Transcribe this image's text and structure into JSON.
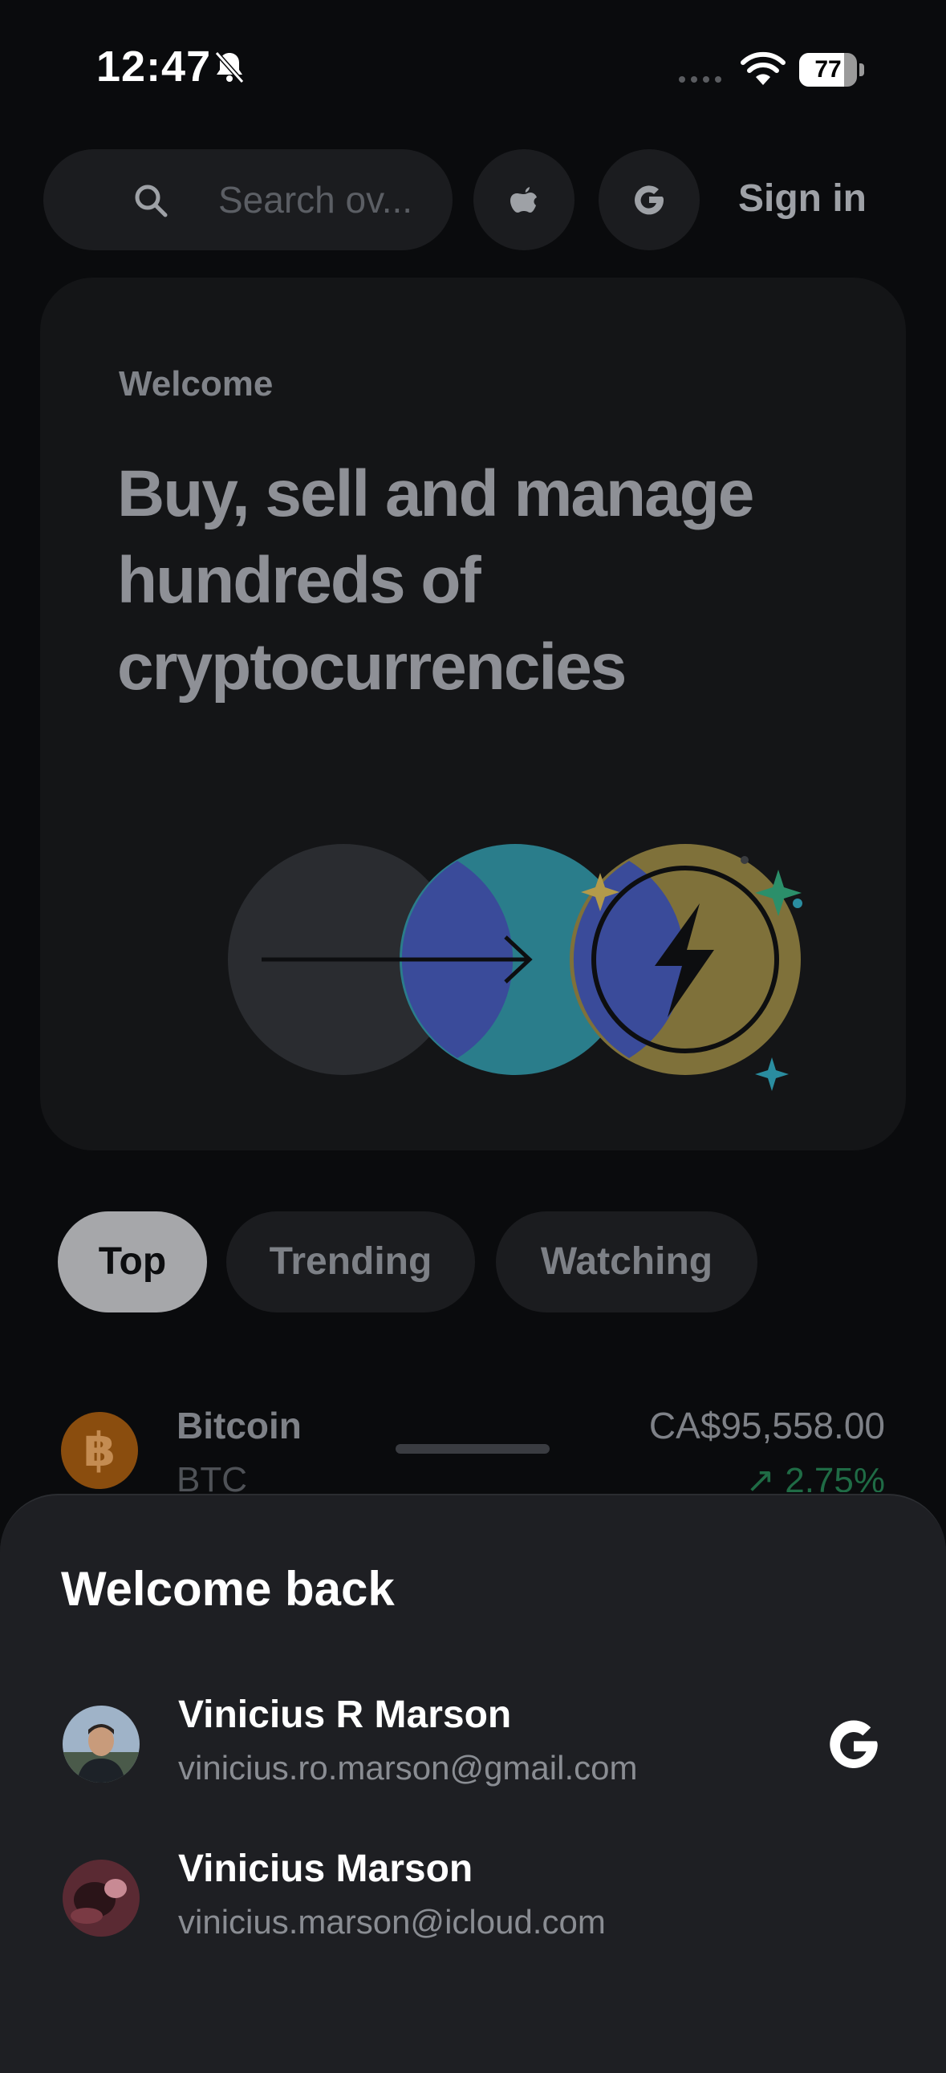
{
  "status_bar": {
    "time": "12:47",
    "battery": "77",
    "battery_level": 0.77,
    "icons": [
      "bell-slash-icon",
      "signal-icon",
      "wifi-icon",
      "battery-icon"
    ]
  },
  "top_bar": {
    "search_placeholder": "Search ov...",
    "apple_icon": "apple-icon",
    "google_icon": "google-icon",
    "sign_in": "Sign in"
  },
  "welcome_card": {
    "eyebrow": "Welcome",
    "title": "Buy, sell and manage hundreds of cryptocurrencies"
  },
  "tabs": [
    {
      "label": "Top",
      "active": true
    },
    {
      "label": "Trending",
      "active": false
    },
    {
      "label": "Watching",
      "active": false
    }
  ],
  "assets": [
    {
      "name": "Bitcoin",
      "symbol": "BTC",
      "price": "CA$95,558.00",
      "change": "↗ 2.75%",
      "icon": "bitcoin-icon"
    }
  ],
  "sheet": {
    "title": "Welcome back",
    "accounts": [
      {
        "name": "Vinicius R Marson",
        "email": "vinicius.ro.marson@gmail.com",
        "provider_icon": "google-icon"
      },
      {
        "name": "Vinicius Marson",
        "email": "vinicius.marson@icloud.com",
        "provider_icon": ""
      }
    ]
  },
  "colors": {
    "background": "#0a0b0d",
    "card": "#141517",
    "sheet": "#1e1f23",
    "teal": "#2a7d8b",
    "gold": "#7f713a",
    "blue": "#3a4b9a",
    "positive": "#1f6b45"
  }
}
